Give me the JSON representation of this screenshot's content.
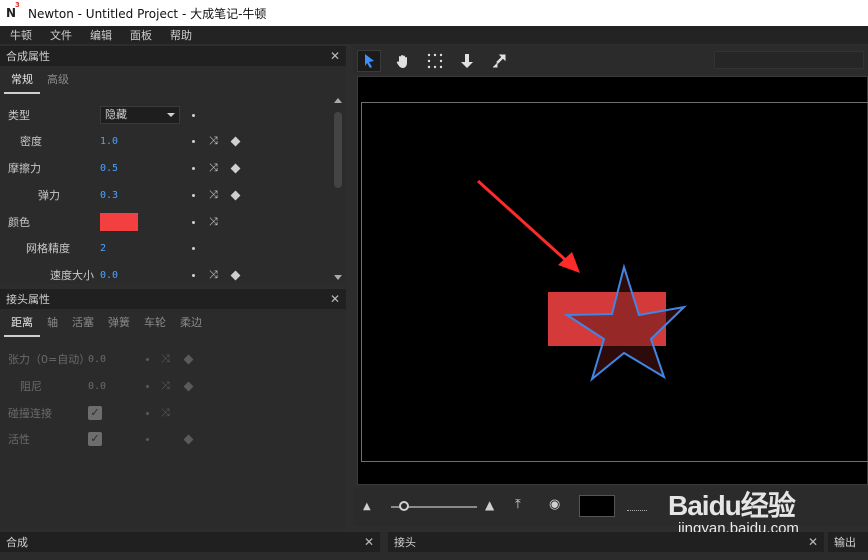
{
  "window": {
    "logo": "N",
    "logo_sup": "3",
    "title": "Newton - Untitled Project - 大成笔记-牛顿"
  },
  "menu": [
    "牛顿",
    "文件",
    "编辑",
    "面板",
    "帮助"
  ],
  "composite_panel": {
    "title": "合成属性",
    "tabs": [
      "常规",
      "高级"
    ],
    "active_tab": "常规",
    "rows": {
      "type": {
        "label": "类型",
        "value": "隐藏"
      },
      "density": {
        "label": "密度",
        "value": "1.0"
      },
      "friction": {
        "label": "摩擦力",
        "value": "0.5"
      },
      "bounce": {
        "label": "弹力",
        "value": "0.3"
      },
      "color": {
        "label": "颜色",
        "swatch": "#f24040"
      },
      "mesh": {
        "label": "网格精度",
        "value": "2"
      },
      "speed": {
        "label": "速度大小",
        "value": "0.0"
      }
    }
  },
  "joint_panel": {
    "title": "接头属性",
    "tabs": [
      "距离",
      "轴",
      "活塞",
      "弹簧",
      "车轮",
      "柔边"
    ],
    "active_tab": "距离",
    "rows": {
      "tension": {
        "label": "张力（0=自动）",
        "value": "0.0"
      },
      "damping": {
        "label": "阻尼",
        "value": "0.0"
      },
      "collide": {
        "label": "碰撞连接",
        "checked": "✓"
      },
      "active": {
        "label": "活性",
        "checked": "✓"
      }
    }
  },
  "viewport": {
    "background": "#000000",
    "rect_color": "#d43a3a",
    "star_stroke": "#3f86e6",
    "arrow_color": "#ff2a2a"
  },
  "toolbar_icons": [
    "select-arrow-icon",
    "hand-icon",
    "grid-icon",
    "drop-down-icon",
    "expand-icon"
  ],
  "bottom_panels": {
    "composite": "合成",
    "joint": "接头",
    "output": "输出"
  },
  "watermark": {
    "brand": "Baidu经验",
    "url": "jingyan.baidu.com"
  }
}
